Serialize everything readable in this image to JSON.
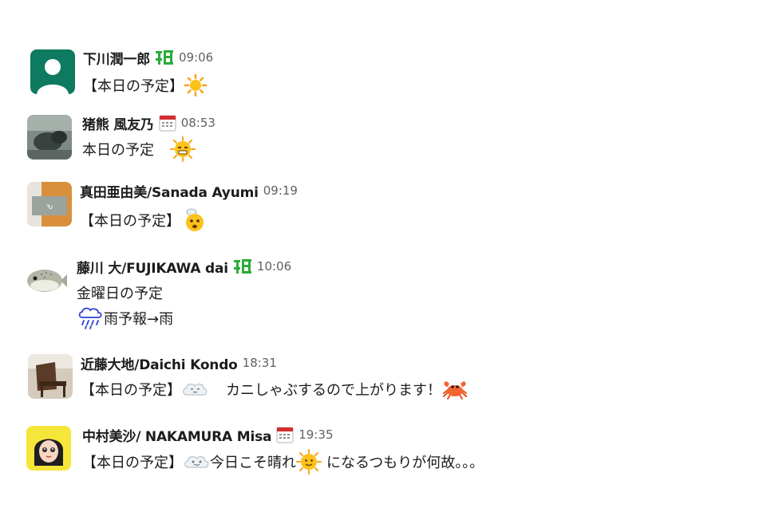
{
  "messages": [
    {
      "name": "下川潤一郎",
      "badge": "leaf-status-icon",
      "time": "09:06",
      "lines": [
        {
          "pre": "【本日の予定】",
          "emoji": "sun-icon",
          "post": ""
        }
      ]
    },
    {
      "name": "猪熊 風友乃",
      "badge": "calendar-status-icon",
      "time": "08:53",
      "lines": [
        {
          "pre": "本日の予定",
          "emoji": "hot-face-icon",
          "post": ""
        }
      ]
    },
    {
      "name": "真田亜由美/Sanada Ayumi",
      "badge": "",
      "time": "09:19",
      "lines": [
        {
          "pre": "【本日の予定】",
          "emoji": "steaming-face-icon",
          "post": ""
        }
      ]
    },
    {
      "name": "藤川 大/FUJIKAWA dai",
      "badge": "leaf-status-icon",
      "time": "10:06",
      "lines": [
        {
          "pre": "金曜日の予定",
          "emoji": "",
          "post": ""
        },
        {
          "pre": "",
          "emoji": "rain-cloud-icon",
          "post": "雨予報→雨"
        }
      ]
    },
    {
      "name": "近藤大地/Daichi Kondo",
      "badge": "",
      "time": "18:31",
      "lines": [
        {
          "pre": "【本日の予定】",
          "emoji": "cloud-face-icon",
          "post": "カニしゃぶするので上がります！",
          "emoji2": "crab-icon"
        }
      ]
    },
    {
      "name": "中村美沙/ NAKAMURA Misa",
      "badge": "calendar-status-icon",
      "time": "19:35",
      "lines": [
        {
          "pre": "【本日の予定】",
          "emoji": "cloud-face-icon",
          "post": "今日こそ晴れ",
          "emoji2": "sun-face-icon",
          "post2": "になるつもりが何故。。。"
        }
      ]
    }
  ],
  "colors": {
    "name": "#1d1c1d",
    "time": "#616061",
    "badge_green": "#2bac3a"
  }
}
